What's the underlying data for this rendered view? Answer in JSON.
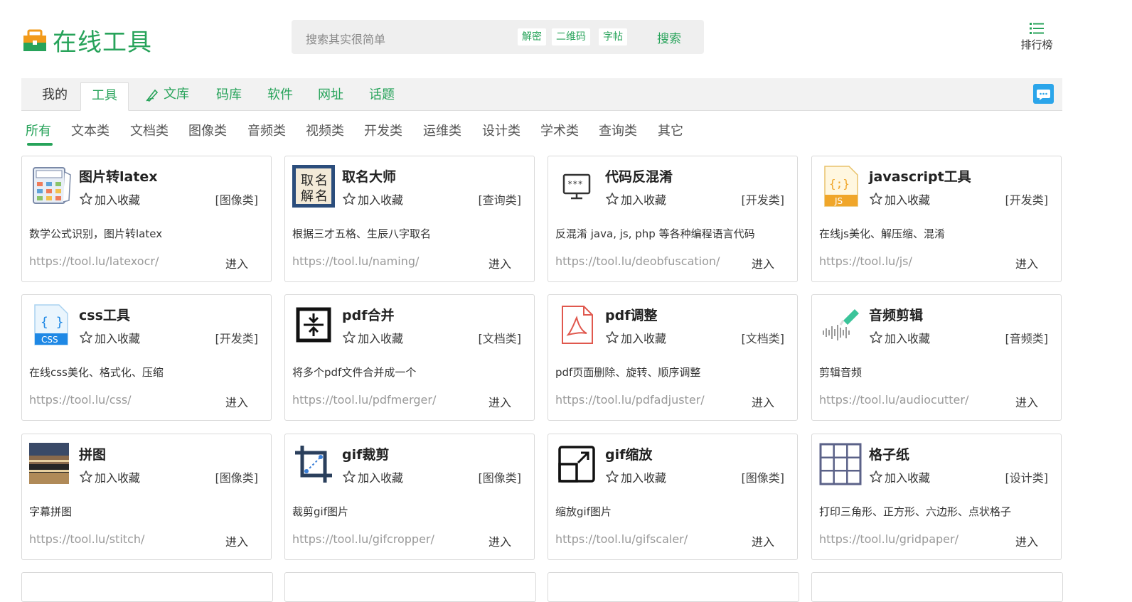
{
  "header": {
    "logo_text": "在线工具",
    "search_placeholder": "搜索其实很简单",
    "search_chips": [
      "解密",
      "二维码",
      "字帖"
    ],
    "search_button": "搜索",
    "rank_label": "排行榜"
  },
  "tabs": [
    {
      "label": "我的"
    },
    {
      "label": "工具"
    },
    {
      "label": "文库"
    },
    {
      "label": "码库"
    },
    {
      "label": "软件"
    },
    {
      "label": "网址"
    },
    {
      "label": "话题"
    }
  ],
  "categories": [
    "所有",
    "文本类",
    "文档类",
    "图像类",
    "音频类",
    "视频类",
    "开发类",
    "运维类",
    "设计类",
    "学术类",
    "查询类",
    "其它"
  ],
  "fav_label": "加入收藏",
  "enter_label": "进入",
  "cards": [
    {
      "title": "图片转latex",
      "category": "[图像类]",
      "desc": "数学公式识别，图片转latex",
      "url": "https://tool.lu/latexocr/",
      "icon": "calculator-icon"
    },
    {
      "title": "取名大师",
      "category": "[查询类]",
      "desc": "根据三才五格、生辰八字取名",
      "url": "https://tool.lu/naming/",
      "icon": "naming-icon"
    },
    {
      "title": "代码反混淆",
      "category": "[开发类]",
      "desc": "反混淆 java, js, php 等各种编程语言代码",
      "url": "https://tool.lu/deobfuscation/",
      "icon": "monitor-code-icon"
    },
    {
      "title": "javascript工具",
      "category": "[开发类]",
      "desc": "在线js美化、解压缩、混淆",
      "url": "https://tool.lu/js/",
      "icon": "js-file-icon"
    },
    {
      "title": "css工具",
      "category": "[开发类]",
      "desc": "在线css美化、格式化、压缩",
      "url": "https://tool.lu/css/",
      "icon": "css-file-icon"
    },
    {
      "title": "pdf合并",
      "category": "[文档类]",
      "desc": "将多个pdf文件合并成一个",
      "url": "https://tool.lu/pdfmerger/",
      "icon": "merge-icon"
    },
    {
      "title": "pdf调整",
      "category": "[文档类]",
      "desc": "pdf页面删除、旋转、顺序调整",
      "url": "https://tool.lu/pdfadjuster/",
      "icon": "pdf-icon"
    },
    {
      "title": "音频剪辑",
      "category": "[音频类]",
      "desc": "剪辑音频",
      "url": "https://tool.lu/audiocutter/",
      "icon": "audio-wave-icon"
    },
    {
      "title": "拼图",
      "category": "[图像类]",
      "desc": "字幕拼图",
      "url": "https://tool.lu/stitch/",
      "icon": "photo-stitch-icon"
    },
    {
      "title": "gif裁剪",
      "category": "[图像类]",
      "desc": "裁剪gif图片",
      "url": "https://tool.lu/gifcropper/",
      "icon": "crop-icon"
    },
    {
      "title": "gif缩放",
      "category": "[图像类]",
      "desc": "缩放gif图片",
      "url": "https://tool.lu/gifscaler/",
      "icon": "scale-icon"
    },
    {
      "title": "格子纸",
      "category": "[设计类]",
      "desc": "打印三角形、正方形、六边形、点状格子",
      "url": "https://tool.lu/gridpaper/",
      "icon": "grid-icon"
    }
  ],
  "colors": {
    "brand": "#27a35a",
    "chat": "#2ba5ea"
  }
}
